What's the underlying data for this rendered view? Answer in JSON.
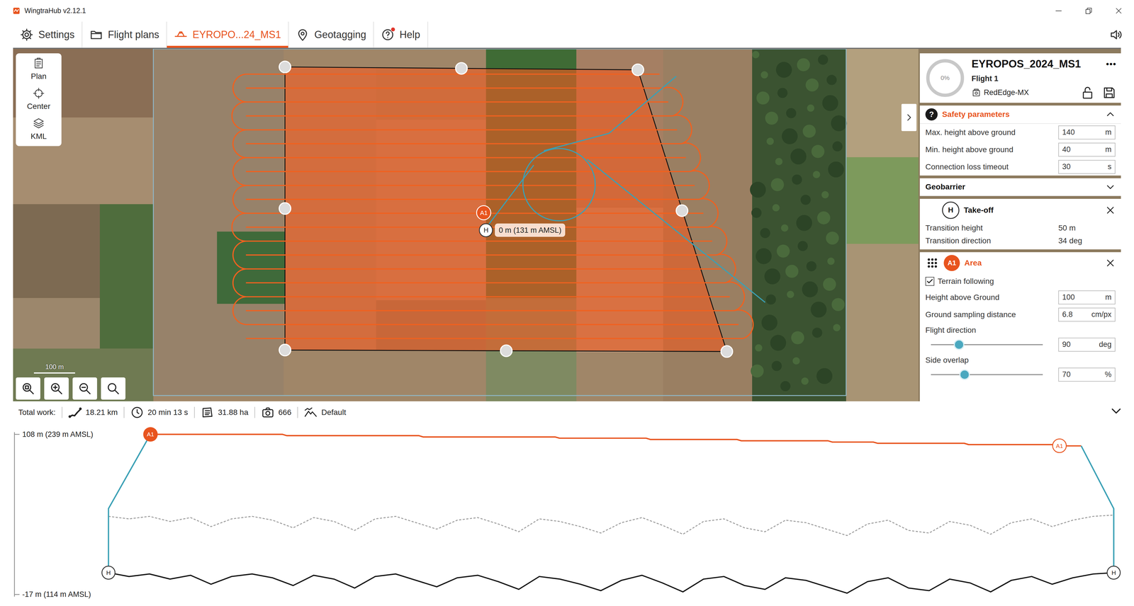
{
  "window": {
    "title": "WingtraHub v2.12.1"
  },
  "tabs": [
    {
      "label": "Settings",
      "selected": false
    },
    {
      "label": "Flight plans",
      "selected": false
    },
    {
      "label": "EYROPO...24_MS1",
      "selected": true
    },
    {
      "label": "Geotagging",
      "selected": false
    },
    {
      "label": "Help",
      "selected": false,
      "badge": true
    }
  ],
  "map_tools": [
    {
      "label": "Plan"
    },
    {
      "label": "Center"
    },
    {
      "label": "KML"
    }
  ],
  "map": {
    "scale": "100 m",
    "home_label": "0 m (131 m AMSL)",
    "markers": [
      {
        "label": "A1",
        "kind": "area"
      },
      {
        "label": "H",
        "kind": "home"
      }
    ]
  },
  "plan": {
    "name": "EYROPOS_2024_MS1",
    "menu": "•••",
    "progress": "0%",
    "progress_level": 0,
    "flight": "Flight 1",
    "camera": "RedEdge-MX"
  },
  "safety": {
    "icon": "?",
    "title": "Safety parameters",
    "expanded": true,
    "fields": [
      {
        "label": "Max. height above ground",
        "value": "140",
        "unit": "m"
      },
      {
        "label": "Min. height above ground",
        "value": "40",
        "unit": "m"
      },
      {
        "label": "Connection loss timeout",
        "value": "30",
        "unit": "s"
      }
    ]
  },
  "geobarrier": {
    "title": "Geobarrier",
    "expanded": false
  },
  "takeoff": {
    "badge": "H",
    "title": "Take-off",
    "rows": [
      {
        "label": "Transition height",
        "value": "50 m"
      },
      {
        "label": "Transition direction",
        "value": "34 deg"
      }
    ]
  },
  "area": {
    "badge": "A1",
    "title": "Area",
    "terrain_following": {
      "label": "Terrain following",
      "checked": true
    },
    "fields": [
      {
        "kind": "input",
        "label": "Height above Ground",
        "value": "100",
        "unit": "m"
      },
      {
        "kind": "input",
        "label": "Ground sampling distance",
        "value": "6.8",
        "unit": "cm/px"
      },
      {
        "kind": "slider",
        "label": "Flight direction",
        "value": "90",
        "unit": "deg",
        "level": 0.25
      },
      {
        "kind": "slider",
        "label": "Side overlap",
        "value": "70",
        "unit": "%",
        "level": 0.3
      }
    ]
  },
  "summary": {
    "label": "Total work:",
    "items": [
      "18.21 km",
      "20 min 13 s",
      "31.88 ha",
      "666",
      "Default"
    ]
  },
  "profile": {
    "top_tick": "108 m (239 m AMSL)",
    "bottom_tick": "-17 m (114 m AMSL)",
    "max": 108,
    "min": -17,
    "transition_height": 50,
    "series": {
      "flight": [
        108,
        108,
        108,
        107,
        107,
        107,
        106,
        106,
        106,
        105,
        105,
        104,
        104,
        103,
        103,
        102,
        101,
        101,
        100,
        100,
        99
      ],
      "terrain": [
        0,
        -3,
        -1,
        -5,
        -2,
        -9,
        -3,
        -1,
        -4,
        -10,
        -2,
        -5,
        -12,
        -3,
        -1,
        -6,
        -11,
        -4,
        -2,
        -7,
        -13,
        -3,
        -5,
        -9,
        -14,
        -6,
        -2,
        -8,
        -15,
        -5,
        -3,
        -10,
        -13,
        -4,
        -6,
        -11,
        -16,
        -7,
        -4,
        -12,
        -14,
        -5,
        -8,
        -15,
        -6,
        -3,
        -9,
        -4,
        -1,
        0
      ],
      "min_height": [
        44,
        42,
        44,
        40,
        43,
        36,
        42,
        44,
        41,
        35,
        43,
        40,
        33,
        42,
        44,
        39,
        34,
        41,
        43,
        38,
        32,
        42,
        40,
        36,
        31,
        39,
        43,
        37,
        30,
        40,
        42,
        35,
        32,
        41,
        39,
        34,
        29,
        38,
        41,
        33,
        31,
        40,
        37,
        30,
        39,
        42,
        36,
        41,
        44,
        45
      ]
    },
    "markers": [
      {
        "label": "A1",
        "kind": "start"
      },
      {
        "label": "A1",
        "kind": "end"
      },
      {
        "label": "H",
        "kind": "home"
      },
      {
        "label": "H",
        "kind": "home"
      }
    ]
  }
}
